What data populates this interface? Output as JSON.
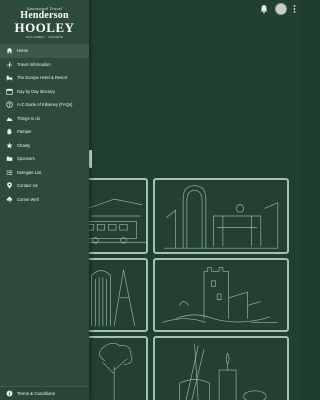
{
  "brand": {
    "script": "Sponsored Travel",
    "name_line1": "Henderson",
    "name_line2": "HOOLEY",
    "tagline": "KILLARNEY · EUROPE"
  },
  "menu": [
    {
      "label": "Home",
      "icon": "home-icon",
      "active": true
    },
    {
      "label": "Travel Information",
      "icon": "plane-icon"
    },
    {
      "label": "The Europe Hotel & Resort",
      "icon": "hotel-icon"
    },
    {
      "label": "Day by Day Itinerary",
      "icon": "calendar-icon"
    },
    {
      "label": "A-Z Guide of Killarney (FAQs)",
      "icon": "question-icon"
    },
    {
      "label": "Things to do",
      "icon": "mountain-icon"
    },
    {
      "label": "Pamper",
      "icon": "hand-icon"
    },
    {
      "label": "Charity",
      "icon": "star-icon"
    },
    {
      "label": "Sponsors",
      "icon": "folder-icon"
    },
    {
      "label": "Delegate List",
      "icon": "list-icon"
    },
    {
      "label": "Contact Us",
      "icon": "location-pin-icon"
    },
    {
      "label": "Comm Well",
      "icon": "clover-icon"
    }
  ],
  "footer": {
    "label": "Terms & Conditions",
    "icon": "info-icon"
  },
  "colors": {
    "drawer": "#2d4a3b",
    "background": "#21402f",
    "tile_border": "#9ec5ad",
    "line_art": "#8fbf9f"
  }
}
